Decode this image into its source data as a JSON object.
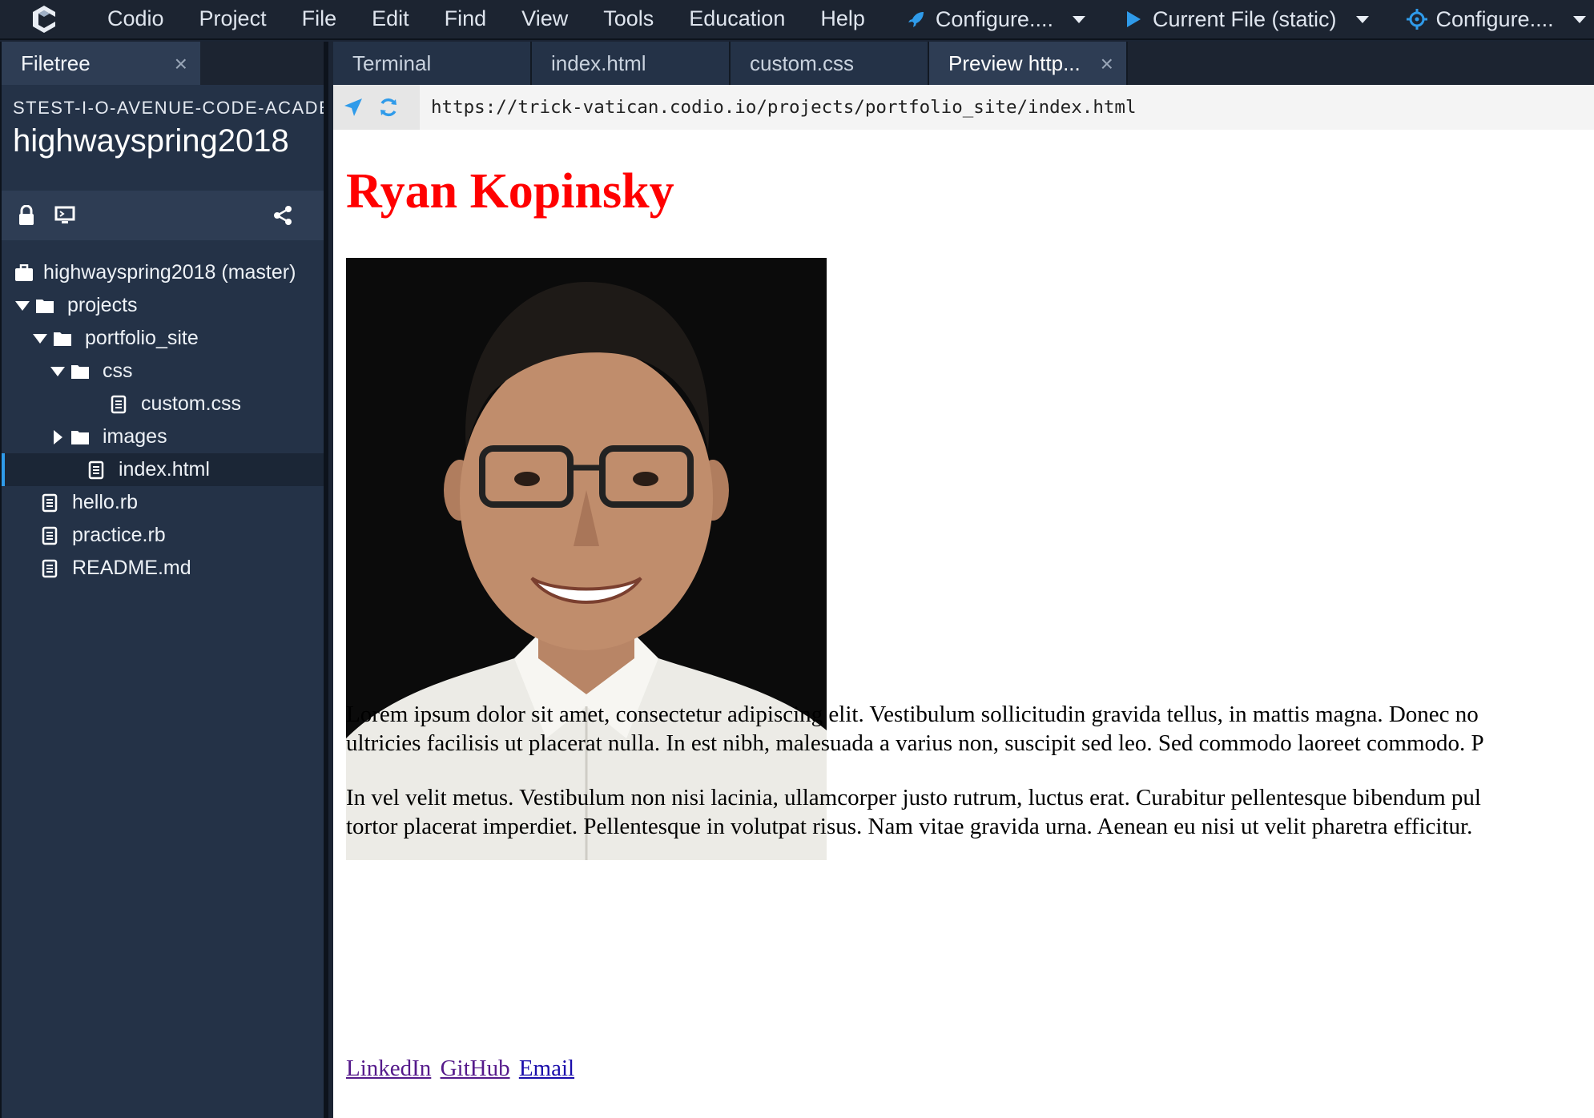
{
  "menubar": {
    "logo_icon": "codio-logo-icon",
    "items": [
      "Codio",
      "Project",
      "File",
      "Edit",
      "Find",
      "View",
      "Tools",
      "Education",
      "Help"
    ],
    "deploy": {
      "icon": "rocket-icon",
      "label": "Configure...."
    },
    "run": {
      "icon": "play-icon",
      "label": "Current File (static)"
    },
    "debug": {
      "icon": "crosshair-icon",
      "label": "Configure...."
    }
  },
  "left_panel": {
    "tab_label": "Filetree",
    "box_name": "STEST-I-O-AVENUE-CODE-ACADEMY",
    "project_name": "highwayspring2018",
    "tree": [
      {
        "label": "highwayspring2018 (master)",
        "type": "repo",
        "depth": 0
      },
      {
        "label": "projects",
        "type": "folder",
        "expanded": true,
        "depth": 1
      },
      {
        "label": "portfolio_site",
        "type": "folder",
        "expanded": true,
        "depth": 2
      },
      {
        "label": "css",
        "type": "folder",
        "expanded": true,
        "depth": 3
      },
      {
        "label": "custom.css",
        "type": "file",
        "depth": 4
      },
      {
        "label": "images",
        "type": "folder",
        "expanded": false,
        "depth": 3
      },
      {
        "label": "index.html",
        "type": "file",
        "depth": 3,
        "selected": true
      },
      {
        "label": "hello.rb",
        "type": "file",
        "depth": 1
      },
      {
        "label": "practice.rb",
        "type": "file",
        "depth": 1
      },
      {
        "label": "README.md",
        "type": "file",
        "depth": 1
      }
    ]
  },
  "tabs": [
    {
      "label": "Terminal",
      "active": false
    },
    {
      "label": "index.html",
      "active": false
    },
    {
      "label": "custom.css",
      "active": false
    },
    {
      "label": "Preview http...",
      "active": true
    }
  ],
  "preview": {
    "url": "https://trick-vatican.codio.io/projects/portfolio_site/index.html",
    "title": "Ryan Kopinsky",
    "p1_line1": "Lorem ipsum dolor sit amet, consectetur adipiscing elit. Vestibulum sollicitudin gravida tellus, in mattis magna. Donec no",
    "p1_line2": "ultricies facilisis ut placerat nulla. In est nibh, malesuada a varius non, suscipit sed leo. Sed commodo laoreet commodo. P",
    "p2_line1": "In vel velit metus. Vestibulum non nisi lacinia, ullamcorper justo rutrum, luctus erat. Curabitur pellentesque bibendum pul",
    "p2_line2": "tortor placerat imperdiet. Pellentesque in volutpat risus. Nam vitae gravida urna. Aenean eu nisi ut velit pharetra efficitur.",
    "links": [
      "LinkedIn",
      "GitHub",
      "Email"
    ]
  },
  "colors": {
    "accent": "#2f9bea",
    "title_red": "#ff0000",
    "link": "#1a0dab",
    "link_visited": "#551a8b"
  }
}
